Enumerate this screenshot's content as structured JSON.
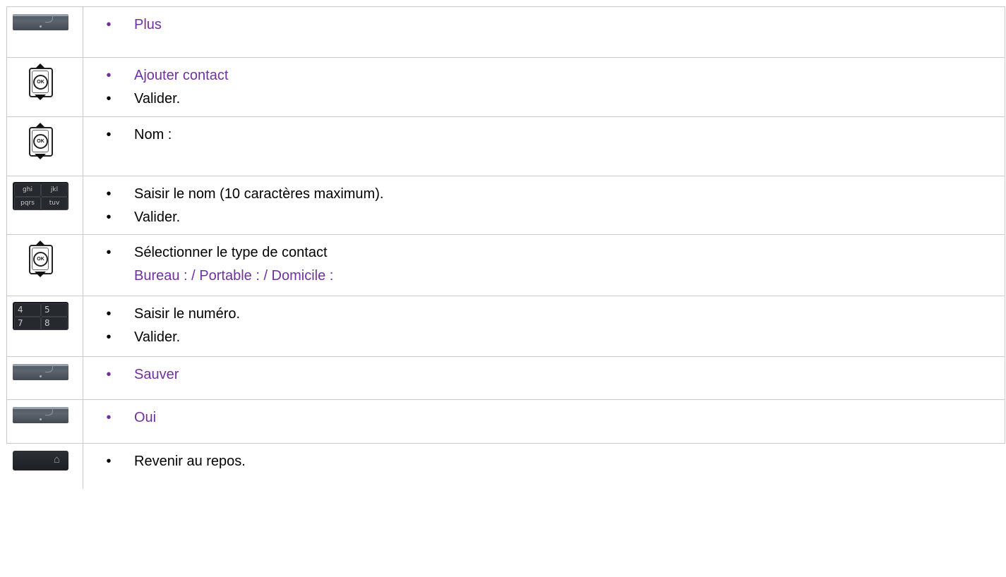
{
  "steps": [
    {
      "icon": "softkey-icon",
      "items": [
        {
          "text": "Plus",
          "style": "purple"
        }
      ]
    },
    {
      "icon": "navigator-ok-icon",
      "items": [
        {
          "text": "Ajouter contact",
          "style": "purple"
        },
        {
          "text": "Valider.",
          "style": "black"
        }
      ]
    },
    {
      "icon": "navigator-ok-icon",
      "items": [
        {
          "text": "Nom :",
          "style": "black"
        }
      ]
    },
    {
      "icon": "alpha-keypad-icon",
      "items": [
        {
          "text": "Saisir le nom (10 caractères maximum).",
          "style": "black"
        },
        {
          "text": "Valider.",
          "style": "black"
        }
      ]
    },
    {
      "icon": "navigator-ok-icon",
      "items": [
        {
          "text": "Sélectionner le type de contact",
          "style": "black",
          "sub": "Bureau : / Portable : / Domicile :"
        }
      ]
    },
    {
      "icon": "numeric-keypad-icon",
      "items": [
        {
          "text": "Saisir le numéro.",
          "style": "black"
        },
        {
          "text": "Valider.",
          "style": "black"
        }
      ]
    },
    {
      "icon": "softkey-icon",
      "items": [
        {
          "text": "Sauver",
          "style": "purple"
        }
      ]
    },
    {
      "icon": "softkey-icon",
      "items": [
        {
          "text": "Oui",
          "style": "purple"
        }
      ]
    },
    {
      "icon": "home-key-icon",
      "items": [
        {
          "text": "Revenir au repos.",
          "style": "black"
        }
      ]
    }
  ],
  "icons": {
    "navigator_label": "OK",
    "alpha_keys": [
      "ghi",
      "jkl",
      "pqrs",
      "tuv"
    ],
    "numeric_keys": [
      "4",
      "5",
      "7",
      "8"
    ],
    "home_glyph": "⌂"
  },
  "colors": {
    "accent": "#7030a0",
    "text": "#000000",
    "border": "#c9c9c9"
  }
}
